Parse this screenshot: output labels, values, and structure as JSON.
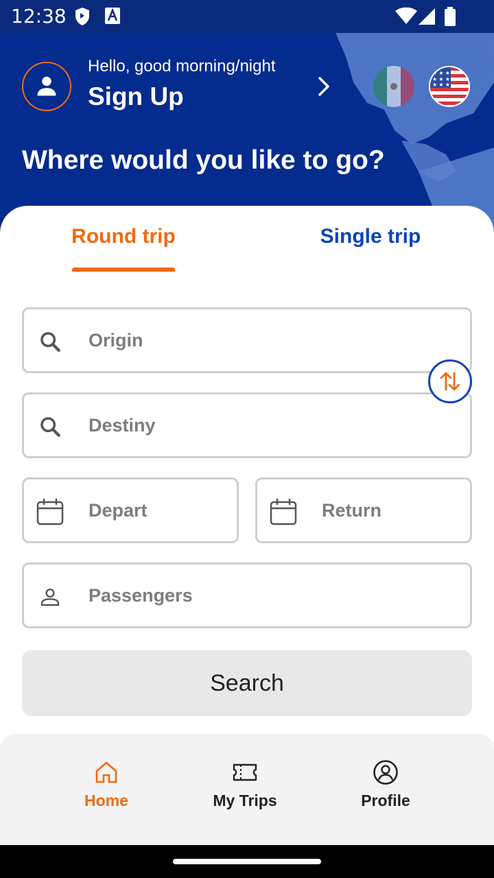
{
  "status_bar": {
    "time": "12:38"
  },
  "header": {
    "greeting": "Hello, good morning/night",
    "sign_up": "Sign Up",
    "headline": "Where would you like to go?",
    "languages": [
      "mexico-flag-icon",
      "usa-flag-icon"
    ]
  },
  "tabs": {
    "round_trip": "Round trip",
    "single_trip": "Single trip",
    "active": "Round trip"
  },
  "form": {
    "origin_placeholder": "Origin",
    "destiny_placeholder": "Destiny",
    "depart_placeholder": "Depart",
    "return_placeholder": "Return",
    "passengers_placeholder": "Passengers",
    "search_label": "Search"
  },
  "bottom_nav": {
    "home": "Home",
    "my_trips": "My Trips",
    "profile": "Profile",
    "active": "Home"
  },
  "colors": {
    "brand_blue": "#042b8e",
    "accent_orange": "#f26a0f",
    "link_blue": "#0a44b8"
  }
}
